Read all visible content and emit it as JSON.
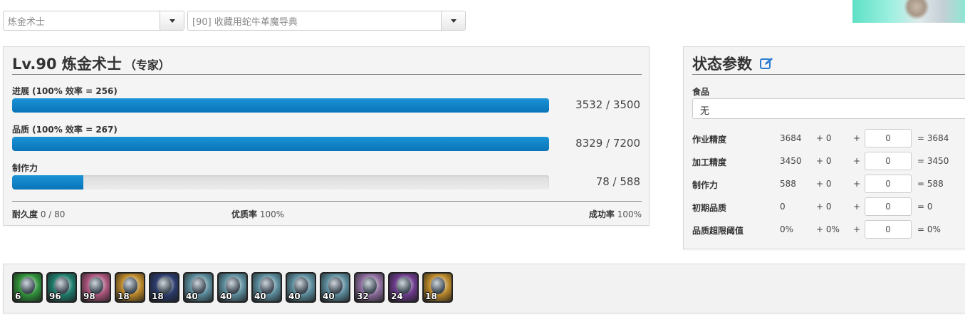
{
  "selects": {
    "class": "炼金术士",
    "recipe": "[90] 收藏用蛇牛革魔导典"
  },
  "craft": {
    "title": "Lv.90 炼金术士",
    "title_suffix": "（专家）",
    "progress": {
      "label": "进展 (100% 效率 = 256)",
      "value": "3532 / 3500",
      "fraction": 1.0
    },
    "quality": {
      "label": "品质  (100% 效率 = 267)",
      "value": "8329 / 7200",
      "fraction": 1.0
    },
    "cp": {
      "label": "制作力",
      "value": "78 / 588",
      "fraction": 0.133
    },
    "durability": {
      "label": "耐久度",
      "value": "0 / 80"
    },
    "hq_rate": {
      "label": "优质率",
      "value": "100%"
    },
    "success_rate": {
      "label": "成功率",
      "value": "100%"
    }
  },
  "stats": {
    "title": "状态参数",
    "edit_icon": "edit-icon",
    "food_label": "食品",
    "food_value": "无",
    "rows": [
      {
        "name": "作业精度",
        "base": "3684",
        "bonus": "+ 0",
        "plus": "+",
        "input": "0",
        "total": "= 3684"
      },
      {
        "name": "加工精度",
        "base": "3450",
        "bonus": "+ 0",
        "plus": "+",
        "input": "0",
        "total": "= 3450"
      },
      {
        "name": "制作力",
        "base": "588",
        "bonus": "+ 0",
        "plus": "+",
        "input": "0",
        "total": "= 588"
      },
      {
        "name": "初期品质",
        "base": "0",
        "bonus": "+ 0",
        "plus": "+",
        "input": "0",
        "total": "= 0"
      },
      {
        "name": "品质超限阈值",
        "base": "0%",
        "bonus": "+ 0%",
        "plus": "+",
        "input": "0",
        "total": "= 0%"
      }
    ]
  },
  "skills": [
    {
      "icon": "muscle-memory-icon",
      "count": "6",
      "color": "#2f8f3a"
    },
    {
      "icon": "veneration-icon",
      "count": "96",
      "color": "#1f7a6a"
    },
    {
      "icon": "great-strides-icon",
      "count": "98",
      "color": "#a8547a"
    },
    {
      "icon": "basic-synthesis-icon",
      "count": "18",
      "color": "#b8862a"
    },
    {
      "icon": "prudent-touch-icon",
      "count": "18",
      "color": "#2a3a6a"
    },
    {
      "icon": "basic-touch-icon",
      "count": "40",
      "color": "#5a8a9a"
    },
    {
      "icon": "basic-touch-icon",
      "count": "40",
      "color": "#5a8a9a"
    },
    {
      "icon": "basic-touch-icon",
      "count": "40",
      "color": "#5a8a9a"
    },
    {
      "icon": "basic-touch-icon",
      "count": "40",
      "color": "#5a8a9a"
    },
    {
      "icon": "basic-touch-icon",
      "count": "40",
      "color": "#5a8a9a"
    },
    {
      "icon": "innovation-icon",
      "count": "32",
      "color": "#8a6a9a"
    },
    {
      "icon": "byregots-blessing-icon",
      "count": "24",
      "color": "#6a3a8a"
    },
    {
      "icon": "basic-synthesis-icon",
      "count": "18",
      "color": "#b8862a"
    }
  ],
  "colors": {
    "bar_fill": "#0a7cc1",
    "panel_bg": "#f4f4f4"
  }
}
